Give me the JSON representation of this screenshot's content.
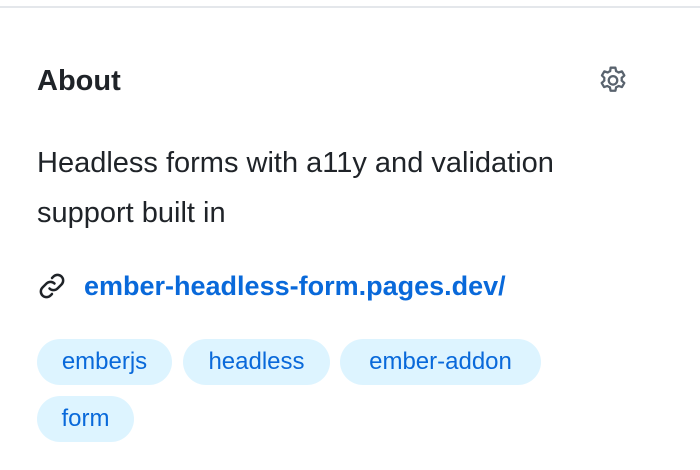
{
  "about": {
    "title": "About",
    "settings_icon": "gear-icon",
    "description": "Headless forms with a11y and validation support built in",
    "website": {
      "icon": "link-icon",
      "url": "ember-headless-form.pages.dev/"
    },
    "topics": [
      "emberjs",
      "headless",
      "ember-addon",
      "form"
    ]
  },
  "colors": {
    "link": "#0969da",
    "topic_bg": "#ddf4ff",
    "text": "#1f2328"
  }
}
